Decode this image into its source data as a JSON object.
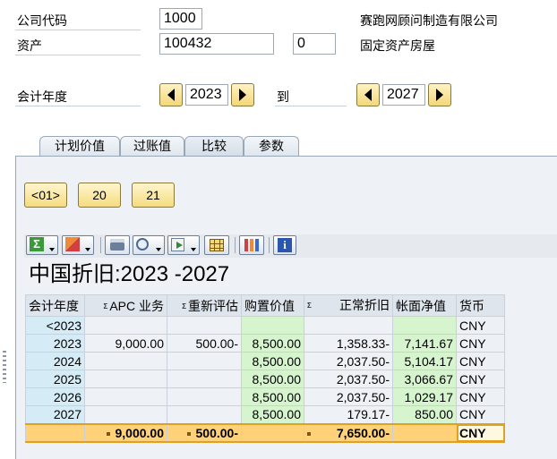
{
  "header": {
    "company_code_label": "公司代码",
    "company_code_value": "1000",
    "company_name": "赛跑网顾问制造有限公司",
    "asset_label": "资产",
    "asset_value": "100432",
    "asset_sub_value": "0",
    "asset_desc": "固定资产房屋",
    "fiscal_year_label": "会计年度",
    "from_year": "2023",
    "to_label": "到",
    "to_year": "2027"
  },
  "tabs": [
    {
      "label": "计划价值"
    },
    {
      "label": "过账值"
    },
    {
      "label": "比较"
    },
    {
      "label": "参数"
    }
  ],
  "buttons": {
    "period_01": "<01>",
    "period_20": "20",
    "period_21": "21"
  },
  "grid": {
    "title": "中国折旧:2023 -2027",
    "columns": [
      "会计年度",
      "APC 业务",
      "重新评估",
      "购置价值",
      "正常折旧",
      "帐面净值",
      "货币"
    ],
    "sigma_symbol": "Σ",
    "rows": [
      {
        "year": "<2023",
        "apc": "",
        "reval": "",
        "acq": "",
        "dep": "",
        "nbv": "",
        "cur": "CNY"
      },
      {
        "year": "2023",
        "apc": "9,000.00",
        "reval": "500.00-",
        "acq": "8,500.00",
        "dep": "1,358.33-",
        "nbv": "7,141.67",
        "cur": "CNY"
      },
      {
        "year": "2024",
        "apc": "",
        "reval": "",
        "acq": "8,500.00",
        "dep": "2,037.50-",
        "nbv": "5,104.17",
        "cur": "CNY"
      },
      {
        "year": "2025",
        "apc": "",
        "reval": "",
        "acq": "8,500.00",
        "dep": "2,037.50-",
        "nbv": "3,066.67",
        "cur": "CNY"
      },
      {
        "year": "2026",
        "apc": "",
        "reval": "",
        "acq": "8,500.00",
        "dep": "2,037.50-",
        "nbv": "1,029.17",
        "cur": "CNY"
      },
      {
        "year": "2027",
        "apc": "",
        "reval": "",
        "acq": "8,500.00",
        "dep": "179.17-",
        "nbv": "850.00",
        "cur": "CNY"
      }
    ],
    "total": {
      "apc": "9,000.00",
      "reval": "500.00-",
      "dep": "7,650.00-",
      "cur": "CNY"
    }
  },
  "toolbar_icons": [
    "sum-icon",
    "subtotal-icon",
    "print-icon",
    "view-icon",
    "export-icon",
    "layout-icon",
    "chart-icon",
    "info-icon"
  ]
}
